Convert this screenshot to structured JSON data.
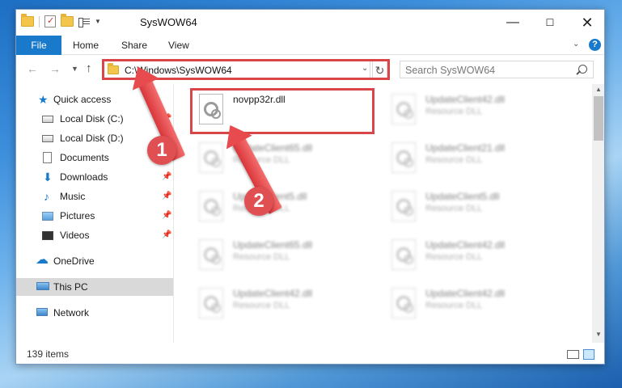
{
  "window": {
    "title": "SysWOW64",
    "minimize_glyph": "—",
    "maximize_glyph": "☐",
    "close_glyph": "✕"
  },
  "ribbon": {
    "file_tab": "File",
    "home_tab": "Home",
    "share_tab": "Share",
    "view_tab": "View",
    "help_glyph": "?"
  },
  "address_bar": {
    "path": "C:\\Windows\\SysWOW64",
    "search_placeholder": "Search SysWOW64"
  },
  "nav_pane": {
    "quick_access": "Quick access",
    "local_disk_c": "Local Disk (C:)",
    "local_disk_d": "Local Disk (D:)",
    "documents": "Documents",
    "downloads": "Downloads",
    "music": "Music",
    "pictures": "Pictures",
    "videos": "Videos",
    "onedrive": "OneDrive",
    "this_pc": "This PC",
    "network": "Network"
  },
  "files": [
    {
      "name": "novpp32r.dll",
      "type": ""
    },
    {
      "name": "UpdateClient42.dll",
      "type": "Resource DLL"
    },
    {
      "name": "UpdateClient65.dll",
      "type": "Resource DLL"
    },
    {
      "name": "UpdateClient21.dll",
      "type": "Resource DLL"
    },
    {
      "name": "UpdateClient5.dll",
      "type": "Resource DLL"
    },
    {
      "name": "UpdateClient5.dll",
      "type": "Resource DLL"
    },
    {
      "name": "UpdateClient65.dll",
      "type": "Resource DLL"
    },
    {
      "name": "UpdateClient42.dll",
      "type": "Resource DLL"
    },
    {
      "name": "UpdateClient42.dll",
      "type": "Resource DLL"
    },
    {
      "name": "UpdateClient42.dll",
      "type": "Resource DLL"
    }
  ],
  "status_bar": {
    "item_count": "139 items"
  },
  "annotations": {
    "step1": "1",
    "step2": "2",
    "color": "#d9464a"
  }
}
